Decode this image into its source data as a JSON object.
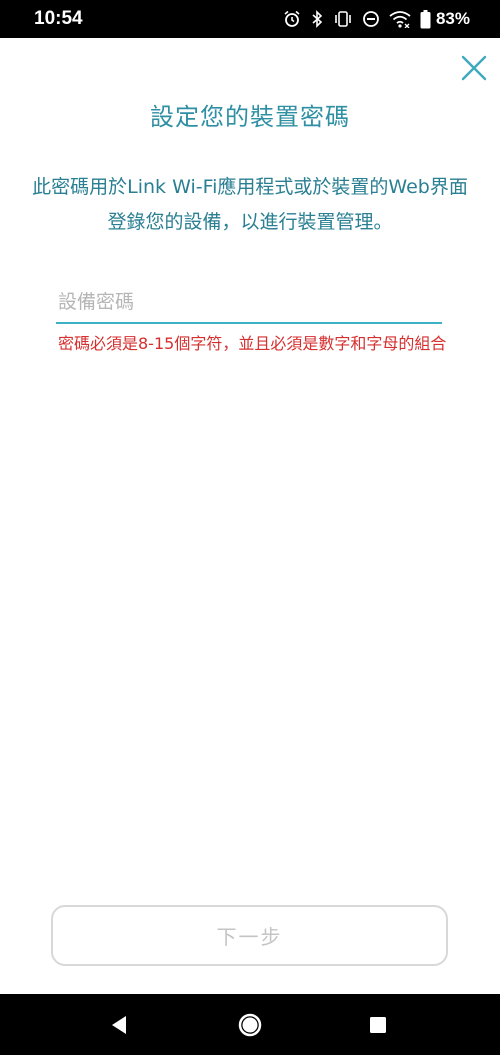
{
  "status_bar": {
    "time": "10:54",
    "battery": "83%",
    "icons": [
      "alarm-icon",
      "bluetooth-icon",
      "vibrate-icon",
      "do-not-disturb-icon",
      "wifi-icon",
      "battery-icon"
    ]
  },
  "header": {
    "close_icon": "close-icon",
    "title": "設定您的裝置密碼"
  },
  "description": "此密碼用於Link Wi-Fi應用程式或於裝置的Web界面登錄您的設備，以進行裝置管理。",
  "password_field": {
    "placeholder": "設備密碼",
    "value": "",
    "error": "密碼必須是8-15個字符，並且必須是數字和字母的組合"
  },
  "next_button": {
    "label": "下一步",
    "enabled": false
  },
  "nav_bar": {
    "icons": [
      "back-icon",
      "home-icon",
      "recents-icon"
    ]
  },
  "colors": {
    "accent": "#2f8fa3",
    "input_underline": "#3fb1c4",
    "error": "#d62f2f",
    "disabled": "#c4c4c4"
  }
}
